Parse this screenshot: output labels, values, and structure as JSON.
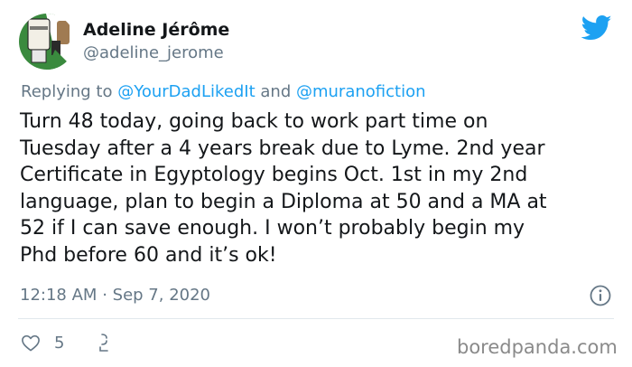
{
  "user": {
    "name": "Adeline Jérôme",
    "handle": "@adeline_jerome"
  },
  "reply": {
    "prefix": "Replying to",
    "mention_1": "@YourDadLikedIt",
    "conjunction": "and",
    "mention_2": "@muranofiction"
  },
  "tweet": {
    "lines": [
      "Turn 48 today, going back to work part time on",
      "Tuesday after a 4 years break due to Lyme. 2nd year",
      "Certificate in Egyptology begins Oct. 1st in my 2nd",
      "language, plan to begin a Diploma at 50 and a MA at",
      "52 if I can save enough. I won’t probably begin my",
      "Phd before 60 and it’s ok!"
    ],
    "time": "12:18 AM",
    "separator": "·",
    "date": "Sep 7, 2020"
  },
  "actions": {
    "like_count": "5"
  },
  "watermark": "boredpanda.com",
  "colors": {
    "twitter_blue": "#1da1f2",
    "secondary_text": "#657786",
    "primary_text": "#14171a",
    "divider": "#e1e8ed"
  },
  "icons": [
    "twitter-bird-icon",
    "info-icon",
    "heart-icon",
    "share-icon"
  ]
}
